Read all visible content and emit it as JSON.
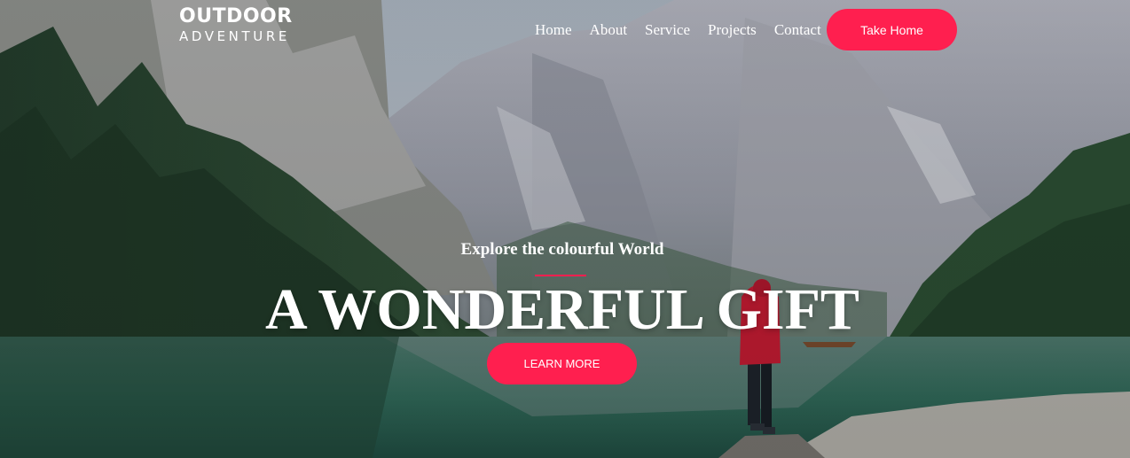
{
  "brand": {
    "name": "OUTDOOR",
    "tagline": "ADVENTURE"
  },
  "nav": {
    "items": [
      "Home",
      "About",
      "Service",
      "Projects",
      "Contact"
    ]
  },
  "header": {
    "cta_label": "Take Home"
  },
  "hero": {
    "subtitle": "Explore the colourful World",
    "title": "A WONDERFUL GIFT",
    "cta_label": "LEARN MORE"
  },
  "colors": {
    "accent": "#ff1f4f"
  }
}
